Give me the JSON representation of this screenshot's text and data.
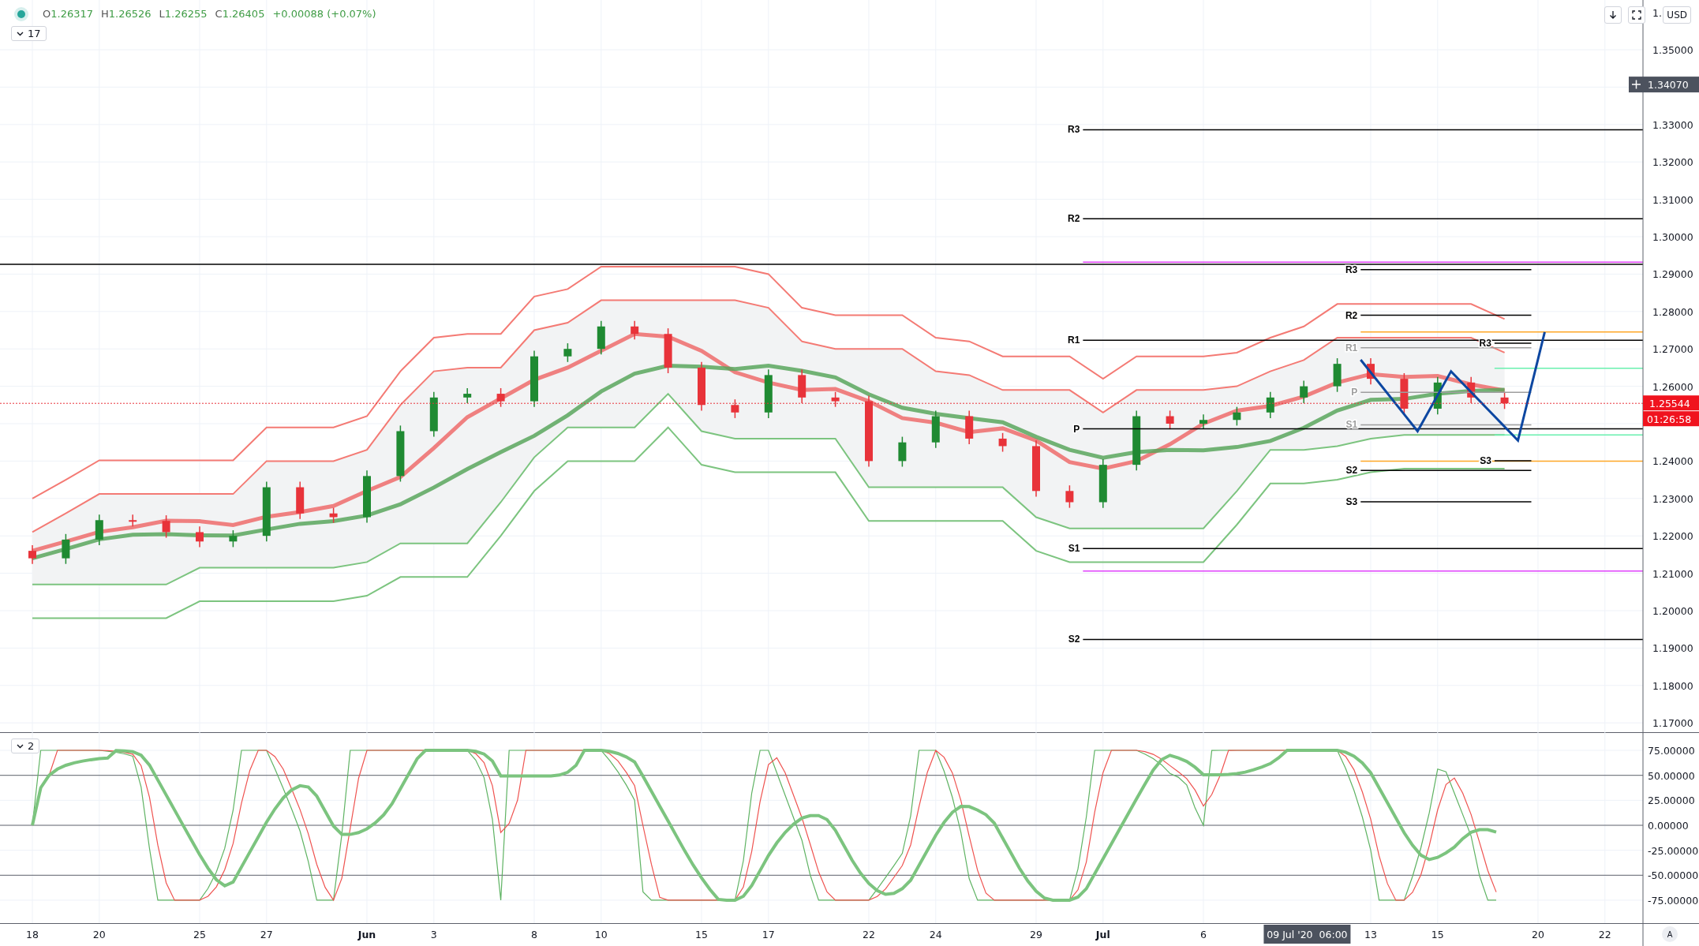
{
  "legend": {
    "items": [
      {
        "label": "O",
        "value": "1.26317"
      },
      {
        "label": "H",
        "value": "1.26526"
      },
      {
        "label": "L",
        "value": "1.26255"
      },
      {
        "label": "C",
        "value": "1.26405"
      }
    ],
    "change": "+0.00088 (+0.07%)"
  },
  "pane_toggle": "17",
  "toolbar": {
    "currency": "USD"
  },
  "price_axis": {
    "labels": [
      "1.",
      "1.35000",
      "1.33000",
      "1.32000",
      "1.31000",
      "1.30000",
      "1.29000",
      "1.28000",
      "1.27000",
      "1.26000",
      "1.24000",
      "1.23000",
      "1.22000",
      "1.21000",
      "1.20000",
      "1.19000",
      "1.18000",
      "1.17000"
    ]
  },
  "pivot_labels": [
    {
      "label": "R3",
      "color": "#000000"
    },
    {
      "label": "R2",
      "color": "#000000"
    },
    {
      "label": "R1",
      "color": "#000000"
    },
    {
      "label": "P",
      "color": "#000000"
    },
    {
      "label": "S1",
      "color": "#000000"
    },
    {
      "label": "S2",
      "color": "#000000"
    },
    {
      "label": "R3",
      "color": "#000000"
    },
    {
      "label": "R2",
      "color": "#000000"
    },
    {
      "label": "R1",
      "color": "#9e9e9e"
    },
    {
      "label": "P",
      "color": "#9e9e9e"
    },
    {
      "label": "S1",
      "color": "#9e9e9e"
    },
    {
      "label": "S2",
      "color": "#000000"
    },
    {
      "label": "S3",
      "color": "#000000"
    },
    {
      "label": "R3",
      "color": "#000000"
    },
    {
      "label": "S3",
      "color": "#000000"
    }
  ],
  "last_price": {
    "price": "1.25544",
    "countdown": "01:26:58"
  },
  "crosshair": {
    "price": "1.34070",
    "time": "09 Jul '20  06:00"
  },
  "oscillator": {
    "toggle": "2",
    "axis_labels": [
      "75.00000",
      "50.00000",
      "25.00000",
      "0.00000",
      "-25.00000",
      "-50.00000",
      "-75.00000"
    ]
  },
  "time_axis": {
    "labels": [
      "18",
      "20",
      "25",
      "27",
      "Jun",
      "3",
      "8",
      "10",
      "15",
      "17",
      "22",
      "24",
      "29",
      "Jul",
      "6",
      "13",
      "15",
      "20",
      "22"
    ]
  },
  "scale_button": "A"
}
